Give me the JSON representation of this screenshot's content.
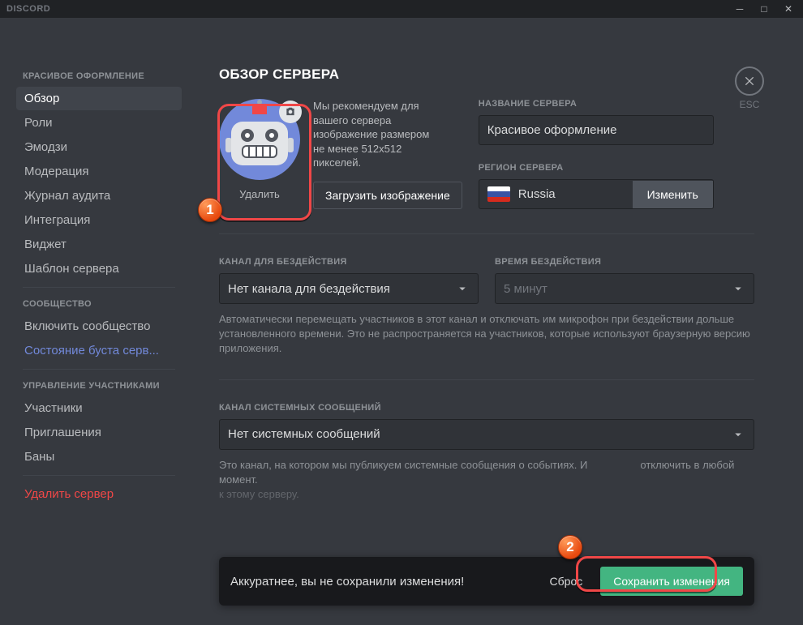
{
  "titlebar": {
    "brand": "DISCORD"
  },
  "esc": {
    "label": "ESC"
  },
  "sidebar": {
    "sections": [
      {
        "label": "КРАСИВОЕ ОФОРМЛЕНИЕ",
        "items": [
          "Обзор",
          "Роли",
          "Эмодзи",
          "Модерация",
          "Журнал аудита",
          "Интеграция",
          "Виджет",
          "Шаблон сервера"
        ]
      },
      {
        "label": "СООБЩЕСТВО",
        "items": [
          "Включить сообщество"
        ],
        "boost": "Состояние буста серв..."
      },
      {
        "label": "УПРАВЛЕНИЕ УЧАСТНИКАМИ",
        "items": [
          "Участники",
          "Приглашения",
          "Баны"
        ]
      }
    ],
    "delete_server": "Удалить сервер"
  },
  "overview": {
    "title": "ОБЗОР СЕРВЕРА",
    "avatar_delete": "Удалить",
    "rec_text": "Мы рекомендуем для вашего сервера изображение размером не менее 512x512 пикселей.",
    "upload_btn": "Загрузить изображение",
    "name_label": "НАЗВАНИЕ СЕРВЕРА",
    "name_value": "Красивое оформление",
    "region_label": "РЕГИОН СЕРВЕРА",
    "region_value": "Russia",
    "region_change": "Изменить",
    "afk_channel_label": "КАНАЛ ДЛЯ БЕЗДЕЙСТВИЯ",
    "afk_channel_value": "Нет канала для бездействия",
    "afk_time_label": "ВРЕМЯ БЕЗДЕЙСТВИЯ",
    "afk_time_value": "5 минут",
    "afk_help": "Автоматически перемещать участников в этот канал и отключать им микрофон при бездействии дольше установленного времени. Это не распространяется на участников, которые используют браузерную версию приложения.",
    "sys_label": "КАНАЛ СИСТЕМНЫХ СООБЩЕНИЙ",
    "sys_value": "Нет системных сообщений",
    "sys_help_1": "Это канал, на котором мы публикуем системные сообщения о событиях. И",
    "sys_help_2": "отключить в любой момент.",
    "sys_help_3": "к этому серверу."
  },
  "savebar": {
    "msg": "Аккуратнее, вы не сохранили изменения!",
    "reset": "Сброс",
    "save": "Сохранить изменения"
  }
}
